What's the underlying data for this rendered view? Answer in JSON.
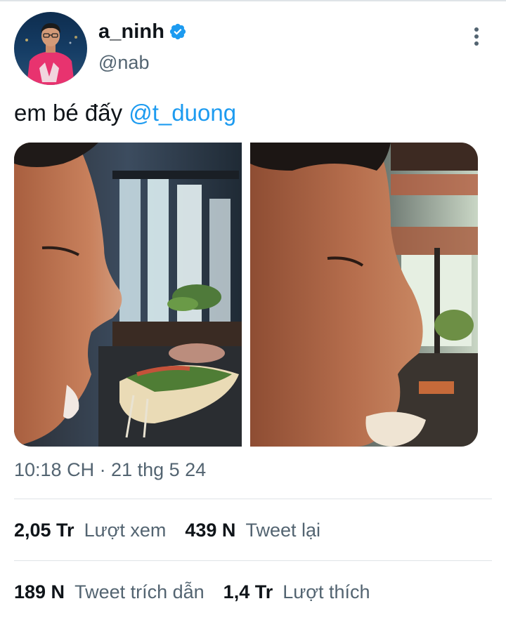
{
  "tweet": {
    "display_name": "a_ninh",
    "handle": "@nab",
    "verified_icon": "verified-badge-icon",
    "more_icon": "more-options-icon",
    "text_prefix": "em bé đấy ",
    "mention": "@t_duong",
    "timestamp": "10:18 CH · 21 thg 5 24"
  },
  "stats": {
    "views_count": "2,05 Tr",
    "views_label": "Lượt xem",
    "retweets_count": "439 N",
    "retweets_label": "Tweet lại",
    "quotes_count": "189 N",
    "quotes_label": "Tweet trích dẫn",
    "likes_count": "1,4 Tr",
    "likes_label": "Lượt thích"
  },
  "colors": {
    "link": "#1d9bf0",
    "secondary_text": "#536471",
    "primary_text": "#0f1419",
    "divider": "#dfe3e7"
  }
}
